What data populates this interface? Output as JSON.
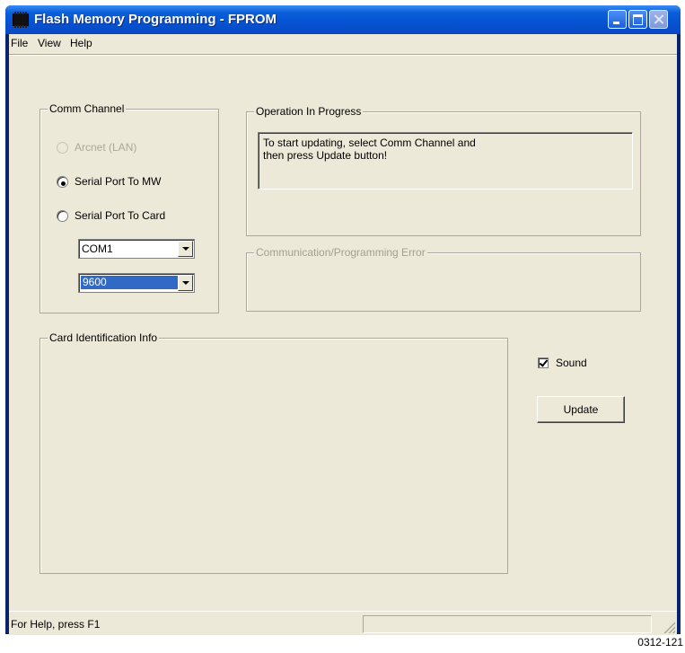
{
  "window": {
    "title": "Flash Memory Programming - FPROM"
  },
  "menu": {
    "items": [
      {
        "label": "File"
      },
      {
        "label": "View"
      },
      {
        "label": "Help"
      }
    ]
  },
  "comm_channel": {
    "title": "Comm Channel",
    "options": [
      {
        "label": "Arcnet (LAN)",
        "selected": false,
        "enabled": false
      },
      {
        "label": "Serial Port To MW",
        "selected": true,
        "enabled": true
      },
      {
        "label": "Serial Port To Card",
        "selected": false,
        "enabled": true
      }
    ],
    "port_select": {
      "value": "COM1"
    },
    "baud_select": {
      "value": "9600"
    }
  },
  "operation": {
    "title": "Operation In Progress",
    "message": "To start updating, select Comm Channel and\nthen press Update button!"
  },
  "error": {
    "title": "Communication/Programming Error",
    "message": ""
  },
  "card_info": {
    "title": "Card Identification Info"
  },
  "sound": {
    "label": "Sound",
    "checked": true
  },
  "update_button": {
    "label": "Update"
  },
  "status": {
    "text": "For Help, press F1"
  },
  "figure_code": "0312-121",
  "colors": {
    "titlebar": "#0654d4",
    "dialog_bg": "#ece9d8",
    "selection": "#316ac5"
  }
}
